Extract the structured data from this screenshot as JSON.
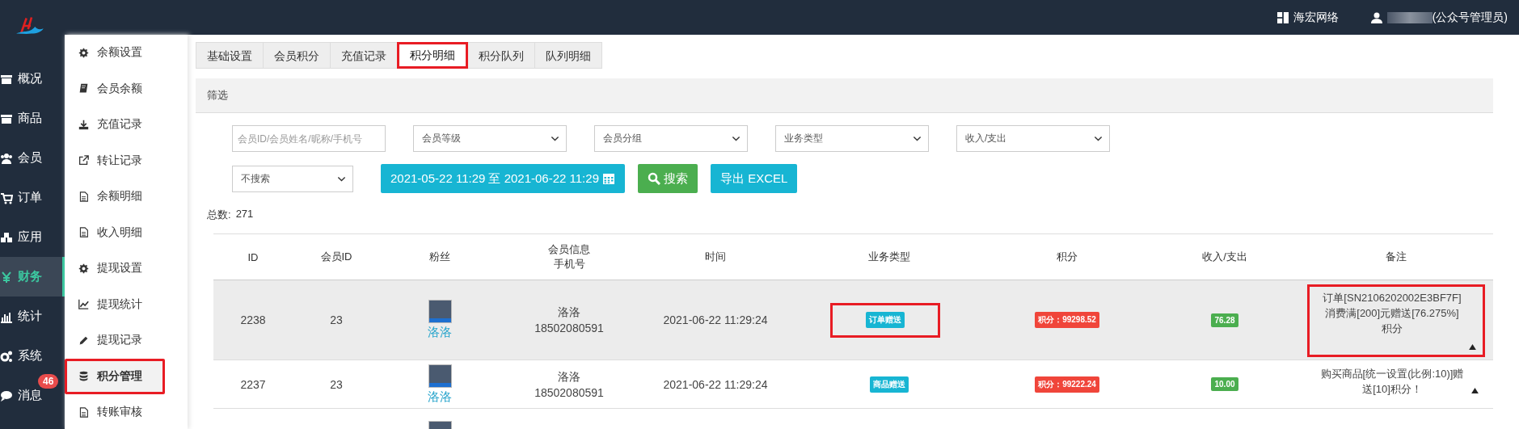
{
  "topbar": {
    "shop": "海宏网络",
    "user": "(公众号管理员)"
  },
  "nav": [
    {
      "label": "概况",
      "selected": false
    },
    {
      "label": "商品",
      "selected": false
    },
    {
      "label": "会员",
      "selected": false
    },
    {
      "label": "订单",
      "selected": false
    },
    {
      "label": "应用",
      "selected": false
    },
    {
      "label": "财务",
      "selected": true
    },
    {
      "label": "统计",
      "selected": false
    },
    {
      "label": "系统",
      "selected": false
    },
    {
      "label": "消息",
      "selected": false,
      "badge": "46"
    }
  ],
  "subnav": [
    {
      "label": "余额设置",
      "selected": false,
      "highlighted": false
    },
    {
      "label": "会员余额",
      "selected": false,
      "highlighted": false
    },
    {
      "label": "充值记录",
      "selected": false,
      "highlighted": false
    },
    {
      "label": "转让记录",
      "selected": false,
      "highlighted": false
    },
    {
      "label": "余额明细",
      "selected": false,
      "highlighted": false
    },
    {
      "label": "收入明细",
      "selected": false,
      "highlighted": false
    },
    {
      "label": "提现设置",
      "selected": false,
      "highlighted": false
    },
    {
      "label": "提现统计",
      "selected": false,
      "highlighted": false
    },
    {
      "label": "提现记录",
      "selected": false,
      "highlighted": false
    },
    {
      "label": "积分管理",
      "selected": true,
      "highlighted": true
    },
    {
      "label": "转账审核",
      "selected": false,
      "highlighted": false
    }
  ],
  "tabs": [
    {
      "label": "基础设置",
      "selected": false,
      "highlighted": false
    },
    {
      "label": "会员积分",
      "selected": false,
      "highlighted": false
    },
    {
      "label": "充值记录",
      "selected": false,
      "highlighted": false
    },
    {
      "label": "积分明细",
      "selected": true,
      "highlighted": true
    },
    {
      "label": "积分队列",
      "selected": false,
      "highlighted": false
    },
    {
      "label": "队列明细",
      "selected": false,
      "highlighted": false
    }
  ],
  "filter": {
    "title": "筛选",
    "fields": [
      {
        "kind": "input",
        "placeholder": "会员ID/会员姓名/昵称/手机号"
      },
      {
        "kind": "select",
        "value": "会员等级"
      },
      {
        "kind": "select",
        "value": "会员分组"
      },
      {
        "kind": "select",
        "value": "业务类型"
      },
      {
        "kind": "select",
        "value": "收入/支出"
      }
    ],
    "search_select": "不搜索",
    "date_range": "2021-05-22 11:29 至 2021-06-22 11:29",
    "search_button": "搜索",
    "export_button": "导出 EXCEL"
  },
  "total": {
    "label": "总数:",
    "value": "271"
  },
  "table": {
    "columns": [
      "ID",
      "会员ID",
      "粉丝",
      "会员信息手机号",
      "时间",
      "业务类型",
      "积分",
      "收入/支出",
      "备注"
    ],
    "rows": [
      {
        "id": "2238",
        "member_id": "23",
        "fan": "洛洛",
        "name": "洛洛",
        "phone": "18502080591",
        "time": "2021-06-22 11:29:24",
        "type": "订单赠送",
        "points": "积分：99298.52",
        "change": "76.28",
        "note": "订单[SN2106202002E3BF7F]消费满[200]元赠送[76.275%]积分",
        "selected": true,
        "highlighted": true
      },
      {
        "id": "2237",
        "member_id": "23",
        "fan": "洛洛",
        "name": "洛洛",
        "phone": "18502080591",
        "time": "2021-06-22 11:29:24",
        "type": "商品赠送",
        "points": "积分：99222.24",
        "change": "10.00",
        "note": "购买商品[统一设置(比例:10)]赠送[10]积分！",
        "selected": false,
        "highlighted": false
      },
      {
        "selected": false,
        "highlighted": false
      }
    ]
  }
}
